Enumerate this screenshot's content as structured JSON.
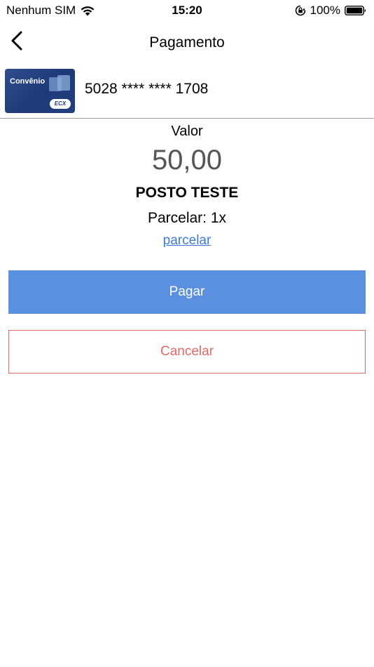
{
  "status_bar": {
    "carrier": "Nenhum SIM",
    "time": "15:20",
    "battery": "100%"
  },
  "nav": {
    "title": "Pagamento"
  },
  "card": {
    "thumb_label": "Convênio",
    "thumb_logo": "ECX",
    "number": "5028 **** **** 1708"
  },
  "payment": {
    "amount_label": "Valor",
    "amount_value": "50,00",
    "merchant": "POSTO TESTE",
    "installments": "Parcelar: 1x",
    "installments_link": "parcelar"
  },
  "actions": {
    "pay_label": "Pagar",
    "cancel_label": "Cancelar"
  },
  "colors": {
    "pay_button": "#5b8fe0",
    "cancel_button": "#e06a66",
    "link": "#3e7ad8",
    "amount": "#555555"
  },
  "icons": {
    "back": "chevron-left-icon",
    "wifi": "wifi-icon",
    "rotation_lock": "rotation-lock-icon",
    "battery": "battery-icon"
  }
}
